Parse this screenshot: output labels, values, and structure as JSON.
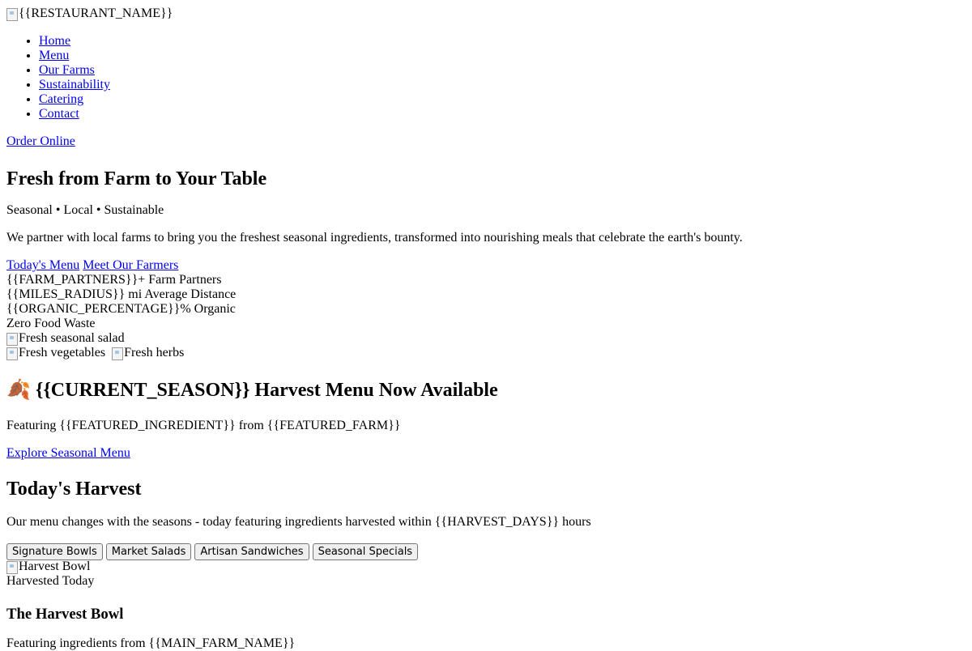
{
  "header": {
    "logo_alt": "{{RESTAURANT_NAME}}",
    "nav": [
      {
        "label": "Home"
      },
      {
        "label": "Menu"
      },
      {
        "label": "Our Farms"
      },
      {
        "label": "Sustainability"
      },
      {
        "label": "Catering"
      },
      {
        "label": "Contact"
      }
    ],
    "order_online": "Order Online"
  },
  "hero": {
    "title": "Fresh from Farm to Your Table",
    "tagline": "Seasonal • Local • Sustainable",
    "description": "We partner with local farms to bring you the freshest seasonal ingredients, transformed into nourishing meals that celebrate the earth's bounty.",
    "cta_primary": "Today's Menu",
    "cta_secondary": "Meet Our Farmers",
    "stats": [
      "{{FARM_PARTNERS}}+ Farm Partners",
      "{{MILES_RADIUS}} mi Average Distance",
      "{{ORGANIC_PERCENTAGE}}% Organic",
      "Zero Food Waste"
    ],
    "images": {
      "main_alt": "Fresh seasonal salad",
      "veg_alt": "Fresh vegetables",
      "herbs_alt": "Fresh herbs"
    }
  },
  "season_banner": {
    "title": "🍂 {{CURRENT_SEASON}} Harvest Menu Now Available",
    "subtitle": "Featuring {{FEATURED_INGREDIENT}} from {{FEATURED_FARM}}",
    "link": "Explore Seasonal Menu"
  },
  "harvest": {
    "title": "Today's Harvest",
    "subtitle": "Our menu changes with the seasons - today featuring ingredients harvested within {{HARVEST_DAYS}} hours",
    "tabs": [
      {
        "label": "Signature Bowls"
      },
      {
        "label": "Market Salads"
      },
      {
        "label": "Artisan Sandwiches"
      },
      {
        "label": "Seasonal Specials"
      }
    ],
    "item": {
      "image_alt": "Harvest Bowl",
      "badge": "Harvested Today",
      "name": "The Harvest Bowl",
      "description": "Featuring ingredients from {{MAIN_FARM_NAME}}"
    }
  }
}
